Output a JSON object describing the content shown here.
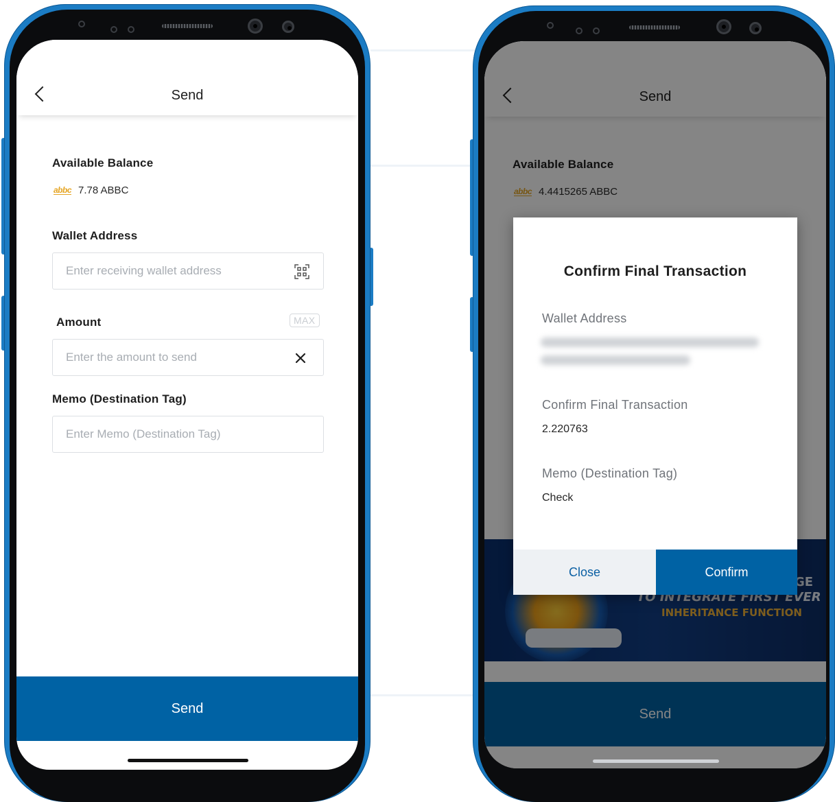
{
  "left_phone": {
    "header": {
      "title": "Send"
    },
    "balance": {
      "label": "Available Balance",
      "coin_logo": "abbc",
      "amount": "7.78 ABBC"
    },
    "wallet": {
      "label": "Wallet Address",
      "placeholder": "Enter receiving wallet address",
      "scan_icon": "qr-scan-icon"
    },
    "amount": {
      "label": "Amount",
      "max_label": "MAX",
      "placeholder": "Enter the amount to send",
      "clear_icon": "close-icon"
    },
    "memo": {
      "label": "Memo (Destination Tag)",
      "placeholder": "Enter Memo (Destination Tag)"
    },
    "send_button": "Send"
  },
  "right_phone": {
    "header": {
      "title": "Send"
    },
    "balance": {
      "label": "Available Balance",
      "coin_logo": "abbc",
      "amount": "4.4415265 ABBC"
    },
    "banner": {
      "line1": "GE",
      "line2": "TO INTEGRATE FIRST EVER",
      "line3": "INHERITANCE FUNCTION"
    },
    "modal": {
      "title": "Confirm Final Transaction",
      "wallet_label": "Wallet Address",
      "amount_label": "Confirm Final Transaction",
      "amount_value": "2.220763",
      "memo_label": "Memo (Destination Tag)",
      "memo_value": "Check",
      "close_label": "Close",
      "confirm_label": "Confirm"
    },
    "send_button": "Send"
  },
  "colors": {
    "primary": "#0062a4",
    "frame": "#1b7cc4",
    "coin": "#e5a524"
  }
}
